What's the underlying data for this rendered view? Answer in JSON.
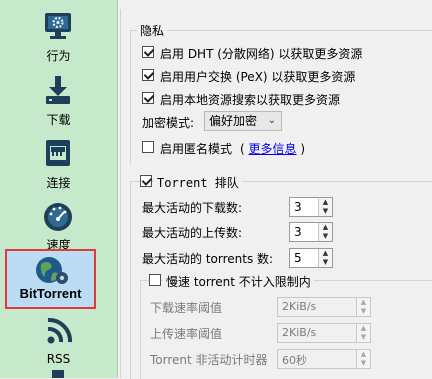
{
  "sidebar": {
    "items": [
      {
        "label": "行为",
        "icon": "monitor-gear-icon"
      },
      {
        "label": "下载",
        "icon": "download-icon"
      },
      {
        "label": "连接",
        "icon": "network-port-icon"
      },
      {
        "label": "速度",
        "icon": "speedometer-icon"
      },
      {
        "label": "BitTorrent",
        "icon": "globe-gear-icon",
        "selected": true
      },
      {
        "label": "RSS",
        "icon": "rss-icon"
      }
    ]
  },
  "privacy": {
    "title": "隐私",
    "dht_label": "启用 DHT (分散网络) 以获取更多资源",
    "pex_label": "启用用户交换 (PeX) 以获取更多资源",
    "lsd_label": "启用本地资源搜索以获取更多资源",
    "encryption_label": "加密模式:",
    "encryption_value": "偏好加密",
    "anon_label": "启用匿名模式",
    "more_info": "更多信息",
    "paren_open": "(",
    "paren_close": ")"
  },
  "queue": {
    "title": "Torrent 排队",
    "max_downloads_label": "最大活动的下载数:",
    "max_downloads": "3",
    "max_uploads_label": "最大活动的上传数:",
    "max_uploads": "3",
    "max_torrents_label": "最大活动的 torrents 数:",
    "max_torrents": "5",
    "slow_label": "慢速 torrent 不计入限制内",
    "dl_threshold_label": "下载速率阈值",
    "dl_threshold": "2KiB/s",
    "ul_threshold_label": "上传速率阈值",
    "ul_threshold": "2KiB/s",
    "timer_label": "Torrent 非活动计时器",
    "timer": "60秒"
  }
}
